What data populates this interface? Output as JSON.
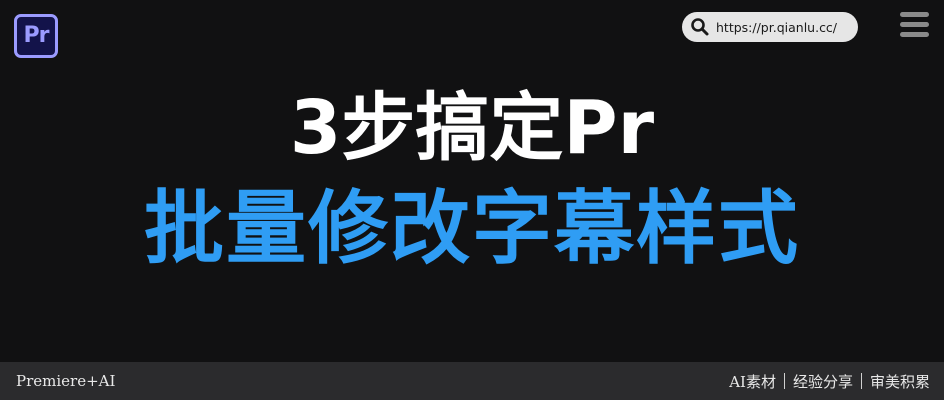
{
  "logo": {
    "text": "Pr"
  },
  "url_bar": {
    "icon": "search-icon",
    "url": "https://pr.qianlu.cc/"
  },
  "menu": {
    "icon": "hamburger-menu-icon"
  },
  "headline": {
    "line1": "3步搞定Pr",
    "line2": "批量修改字幕样式"
  },
  "footer": {
    "left": "Premiere+AI",
    "tags": [
      "AI素材",
      "经验分享",
      "审美积累"
    ]
  },
  "colors": {
    "background": "#111112",
    "accent_blue": "#2f9df4",
    "footer_bg": "#2b2b2d",
    "logo_purple": "#9b9bff",
    "logo_bg": "#13134a"
  }
}
